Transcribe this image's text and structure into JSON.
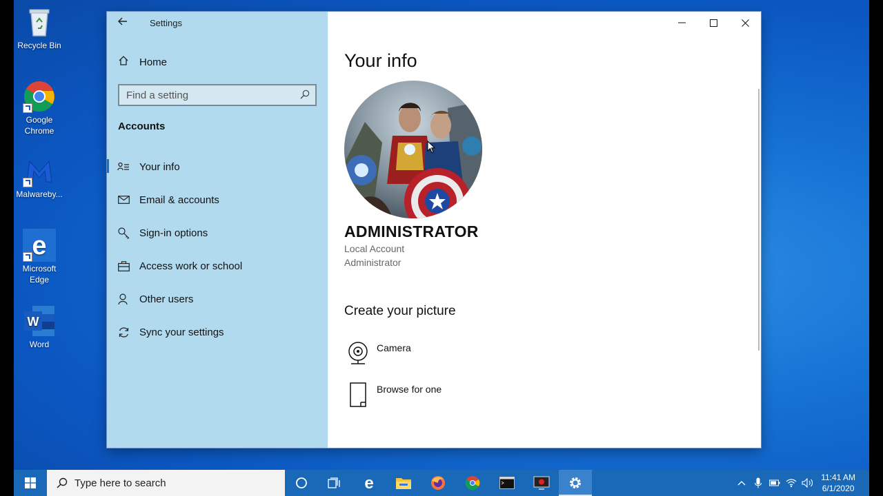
{
  "desktop": {
    "icons": [
      {
        "label": "Recycle Bin",
        "icon": "recycle-bin-icon"
      },
      {
        "label": "Google Chrome",
        "icon": "chrome-icon"
      },
      {
        "label": "Malwareby...",
        "icon": "malwarebytes-icon"
      },
      {
        "label": "Microsoft Edge",
        "icon": "edge-icon"
      },
      {
        "label": "Word",
        "icon": "word-icon"
      }
    ]
  },
  "window": {
    "title": "Settings",
    "back_icon": "back-arrow-icon",
    "controls": {
      "minimize": "minimize-icon",
      "maximize": "maximize-icon",
      "close": "close-icon"
    }
  },
  "sidebar": {
    "home_label": "Home",
    "search_placeholder": "Find a setting",
    "section_header": "Accounts",
    "items": [
      {
        "label": "Your info",
        "icon": "person-card-icon",
        "selected": true
      },
      {
        "label": "Email & accounts",
        "icon": "mail-icon",
        "selected": false
      },
      {
        "label": "Sign-in options",
        "icon": "key-icon",
        "selected": false
      },
      {
        "label": "Access work or school",
        "icon": "briefcase-icon",
        "selected": false
      },
      {
        "label": "Other users",
        "icon": "person-add-icon",
        "selected": false
      },
      {
        "label": "Sync your settings",
        "icon": "sync-icon",
        "selected": false
      }
    ]
  },
  "main": {
    "title": "Your info",
    "user_name": "ADMINISTRATOR",
    "account_type": "Local Account",
    "account_role": "Administrator",
    "create_picture_header": "Create your picture",
    "options": [
      {
        "label": "Camera",
        "icon": "camera-icon"
      },
      {
        "label": "Browse for one",
        "icon": "browse-file-icon"
      }
    ]
  },
  "taskbar": {
    "search_placeholder": "Type here to search",
    "apps": [
      "cortana-icon",
      "task-view-icon",
      "edge-icon",
      "file-explorer-icon",
      "firefox-icon",
      "chrome-icon",
      "terminal-icon",
      "screen-recorder-icon",
      "settings-gear-icon"
    ],
    "active_app": "settings-gear-icon",
    "time": "11:41 AM",
    "date": "6/1/2020"
  },
  "colors": {
    "sidebar_bg": "#b1daef",
    "accent": "#1a6fcb",
    "taskbar": "#1a69b8"
  }
}
